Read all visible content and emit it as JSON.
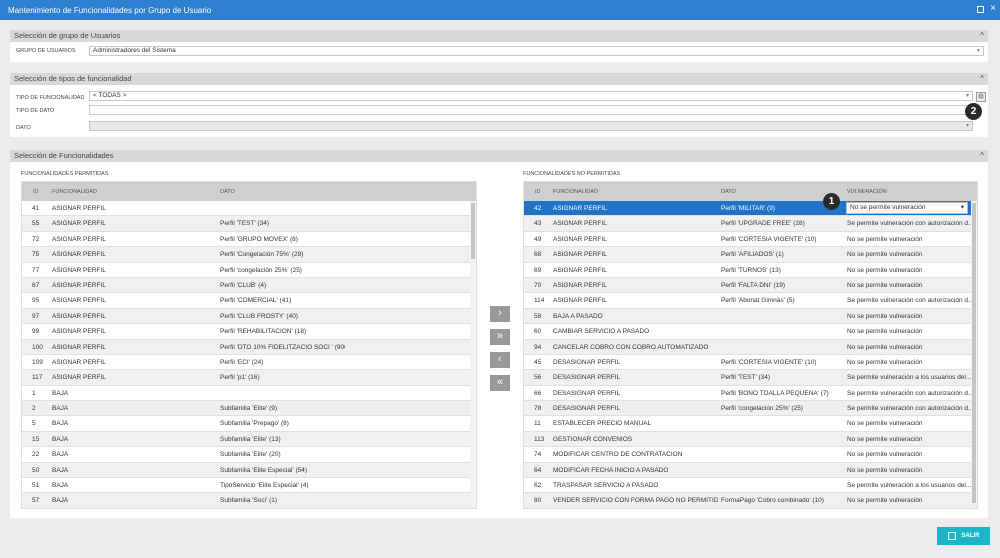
{
  "window": {
    "title": "Mantenimiento de Funcionalidades por Grupo de Usuario"
  },
  "sections": {
    "grupo": {
      "title": "Selección de grupo de Usuarios",
      "label": "GRUPO DE USUARIOS",
      "value": "Administradores del Sistema"
    },
    "tipos": {
      "title": "Selección de tipos de funcionalidad",
      "tipo_label": "TIPO DE FUNCIONALIDAD",
      "tipo_value": "< TODAS >",
      "tipo_dato_label": "TIPO DE DATO",
      "tipo_dato_value": "",
      "dato_label": "DATO",
      "dato_value": ""
    },
    "funcionalidades": {
      "title": "Selección de Funcionalidades"
    }
  },
  "permitidas": {
    "title": "FUNCIONALIDADES PERMITIDAS",
    "columns": {
      "id": "ID",
      "func": "FUNCIONALIDAD",
      "dato": "DATO"
    },
    "rows": [
      {
        "id": "41",
        "func": "ASIGNAR PERFIL",
        "dato": ""
      },
      {
        "id": "55",
        "func": "ASIGNAR PERFIL",
        "dato": "Perfil 'TEST' (34)"
      },
      {
        "id": "72",
        "func": "ASIGNAR PERFIL",
        "dato": "Perfil 'GRUPO MOVEX' (8)"
      },
      {
        "id": "75",
        "func": "ASIGNAR PERFIL",
        "dato": "Perfil 'Congelación 75%' (29)"
      },
      {
        "id": "77",
        "func": "ASIGNAR PERFIL",
        "dato": "Perfil 'congelación 25%' (25)"
      },
      {
        "id": "87",
        "func": "ASIGNAR PERFIL",
        "dato": "Perfil 'CLUB' (4)"
      },
      {
        "id": "95",
        "func": "ASIGNAR PERFIL",
        "dato": "Perfil 'COMERCIAL' (41)"
      },
      {
        "id": "97",
        "func": "ASIGNAR PERFIL",
        "dato": "Perfil 'CLUB FROSTY' (40)"
      },
      {
        "id": "99",
        "func": "ASIGNAR PERFIL",
        "dato": "Perfil 'REHABILITACIÓN' (18)"
      },
      {
        "id": "100",
        "func": "ASIGNAR PERFIL",
        "dato": "Perfil 'DTO 10% FIDELITZACIÓ SOCI ' (900)"
      },
      {
        "id": "109",
        "func": "ASIGNAR PERFIL",
        "dato": "Perfil 'ECI' (24)"
      },
      {
        "id": "117",
        "func": "ASIGNAR PERFIL",
        "dato": "Perfil 'p1' (16)"
      },
      {
        "id": "1",
        "func": "BAJA",
        "dato": ""
      },
      {
        "id": "2",
        "func": "BAJA",
        "dato": "Subfamilia 'Elite' (9)"
      },
      {
        "id": "5",
        "func": "BAJA",
        "dato": "Subfamilia 'Prepago' (8)"
      },
      {
        "id": "15",
        "func": "BAJA",
        "dato": "Subfamilia 'Elite' (13)"
      },
      {
        "id": "22",
        "func": "BAJA",
        "dato": "Subfamilia 'Elite' (20)"
      },
      {
        "id": "50",
        "func": "BAJA",
        "dato": "Subfamilia 'Elite Especial' (54)"
      },
      {
        "id": "51",
        "func": "BAJA",
        "dato": "TipoServicio 'Elite Especial' (4)"
      },
      {
        "id": "57",
        "func": "BAJA",
        "dato": "Subfamilia 'Soci' (1)"
      }
    ]
  },
  "no_permitidas": {
    "title": "FUNCIONALIDADES NO PERMITIDAS",
    "columns": {
      "id": "ID",
      "func": "FUNCIONALIDAD",
      "dato": "DATO",
      "vul": "VULNERACIÓN"
    },
    "rows": [
      {
        "id": "42",
        "func": "ASIGNAR PERFIL",
        "dato": "Perfil 'MILITAR' (9)",
        "vul": "No se permite vulneración"
      },
      {
        "id": "43",
        "func": "ASIGNAR PERFIL",
        "dato": "Perfil 'UPGRADE FREE' (28)",
        "vul": "Se permite vulneración con autorización d..."
      },
      {
        "id": "49",
        "func": "ASIGNAR PERFIL",
        "dato": "Perfil 'CORTESÍA VIGENTE' (10)",
        "vul": "No se permite vulneración"
      },
      {
        "id": "68",
        "func": "ASIGNAR PERFIL",
        "dato": "Perfil 'AFILIADOS' (1)",
        "vul": "No se permite vulneración"
      },
      {
        "id": "69",
        "func": "ASIGNAR PERFIL",
        "dato": "Perfil 'TURNOS' (13)",
        "vul": "No se permite vulneración"
      },
      {
        "id": "70",
        "func": "ASIGNAR PERFIL",
        "dato": "Perfil 'FALTA DNI' (19)",
        "vul": "No se permite vulneración"
      },
      {
        "id": "114",
        "func": "ASIGNAR PERFIL",
        "dato": "Perfil 'Abonat Gimnàs' (5)",
        "vul": "Se permite vulneración con autorización d..."
      },
      {
        "id": "58",
        "func": "BAJA A PASADO",
        "dato": "",
        "vul": "No se permite vulneración"
      },
      {
        "id": "60",
        "func": "CAMBIAR SERVICIO A PASADO",
        "dato": "",
        "vul": "No se permite vulneración"
      },
      {
        "id": "94",
        "func": "CANCELAR COBRO CON COBRO AUTOMATIZADO",
        "dato": "",
        "vul": "No se permite vulneración"
      },
      {
        "id": "45",
        "func": "DESASIGNAR PERFIL",
        "dato": "Perfil 'CORTESÍA VIGENTE' (10)",
        "vul": "No se permite vulneración"
      },
      {
        "id": "56",
        "func": "DESASIGNAR PERFIL",
        "dato": "Perfil 'TEST' (34)",
        "vul": "Se permite vulneración a los usuarios del..."
      },
      {
        "id": "66",
        "func": "DESASIGNAR PERFIL",
        "dato": "Perfil 'BONO TOALLA PEQUEÑA' (7)",
        "vul": "Se permite vulneración con autorización d..."
      },
      {
        "id": "78",
        "func": "DESASIGNAR PERFIL",
        "dato": "Perfil 'congelación 25%' (25)",
        "vul": "Se permite vulneración con autorización d..."
      },
      {
        "id": "11",
        "func": "ESTABLECER PRECIO MANUAL",
        "dato": "",
        "vul": "No se permite vulneración"
      },
      {
        "id": "113",
        "func": "GESTIONAR CONVENIOS",
        "dato": "",
        "vul": "No se permite vulneración"
      },
      {
        "id": "74",
        "func": "MODIFICAR CENTRO DE CONTRATACION",
        "dato": "",
        "vul": "No se permite vulneración"
      },
      {
        "id": "64",
        "func": "MODIFICAR FECHA INICIO A PASADO",
        "dato": "",
        "vul": "No se permite vulneración"
      },
      {
        "id": "62",
        "func": "TRASPASAR SERVICIO A PASADO",
        "dato": "",
        "vul": "Se permite vulneración a los usuarios del..."
      },
      {
        "id": "80",
        "func": "VENDER SERVICIO CON FORMA PAGO NO PERMITIDA CON",
        "dato": "FormaPago 'Cobro combinado' (10)",
        "vul": "No se permite vulneración"
      }
    ]
  },
  "move_buttons": {
    "add": "›",
    "add_all": "»",
    "remove": "‹",
    "remove_all": "«"
  },
  "badges": {
    "one": "1",
    "two": "2"
  },
  "footer": {
    "exit_label": "SALIR"
  },
  "colors": {
    "title_bar": "#2d7fd0",
    "selected_row": "#1f74c8",
    "exit_button": "#1bb7c9"
  }
}
